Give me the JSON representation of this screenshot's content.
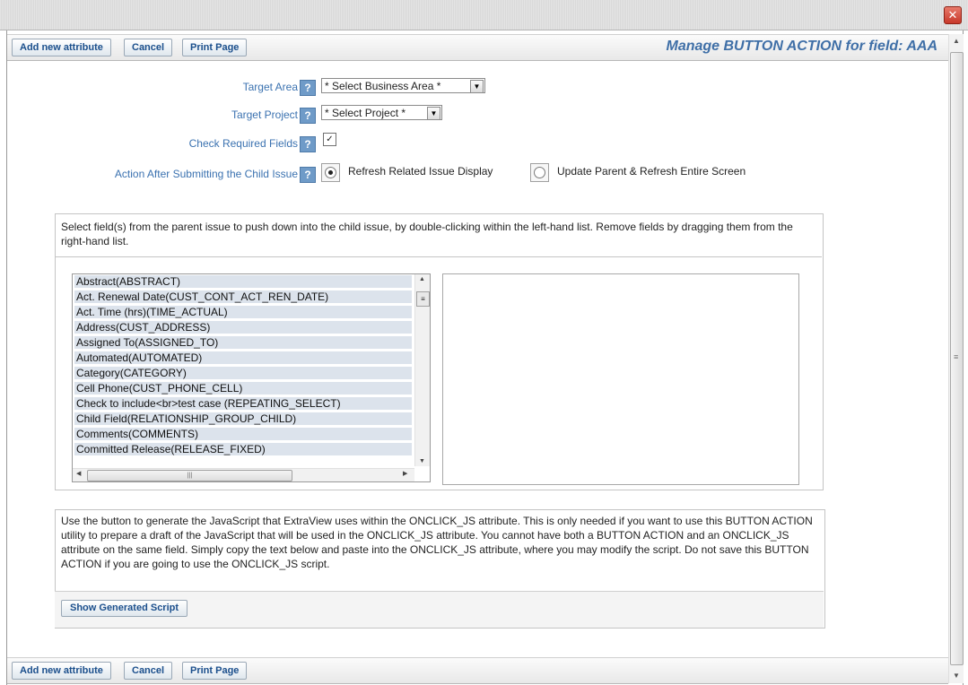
{
  "window": {
    "close_glyph": "✕"
  },
  "toolbar": {
    "add_label": "Add new attribute",
    "cancel_label": "Cancel",
    "print_label": "Print Page",
    "title": "Manage BUTTON ACTION for field: AAA"
  },
  "form": {
    "help_glyph": "?",
    "target_area": {
      "label": "Target Area",
      "value": "* Select Business Area *"
    },
    "target_project": {
      "label": "Target Project",
      "value": "* Select Project *"
    },
    "check_required": {
      "label": "Check Required Fields",
      "checked": true,
      "mark": "☑"
    },
    "action_after": {
      "label": "Action After Submitting the Child Issue",
      "option1": "Refresh Related Issue Display",
      "option2": "Update Parent & Refresh Entire Screen",
      "selected": "option1"
    }
  },
  "fields_panel": {
    "instructions": "Select field(s) from the parent issue to push down into the child issue, by double-clicking within the left-hand list. Remove fields by dragging them from the right-hand list.",
    "items": [
      "Abstract(ABSTRACT)",
      "Act. Renewal Date(CUST_CONT_ACT_REN_DATE)",
      "Act. Time (hrs)(TIME_ACTUAL)",
      "Address(CUST_ADDRESS)",
      "Assigned To(ASSIGNED_TO)",
      "Automated(AUTOMATED)",
      "Category(CATEGORY)",
      "Cell Phone(CUST_PHONE_CELL)",
      "Check to include<br>test case (REPEATING_SELECT)",
      "Child Field(RELATIONSHIP_GROUP_CHILD)",
      "Comments(COMMENTS)",
      "Committed Release(RELEASE_FIXED)"
    ]
  },
  "script_panel": {
    "text": "Use the button to generate the JavaScript that ExtraView uses within the ONCLICK_JS attribute. This is only needed if you want to use this BUTTON ACTION utility to prepare a draft of the JavaScript that will be used in the ONCLICK_JS attribute. You cannot have both a BUTTON ACTION and an ONCLICK_JS attribute on the same field. Simply copy the text below and paste into the ONCLICK_JS attribute, where you may modify the script. Do not save this BUTTON ACTION if you are going to use the ONCLICK_JS script.",
    "button_label": "Show Generated Script"
  },
  "colors": {
    "label_blue": "#3b72b0",
    "title_blue": "#3f6fa7",
    "button_text": "#1b4f8c",
    "list_item_bg": "#dce3ec"
  }
}
